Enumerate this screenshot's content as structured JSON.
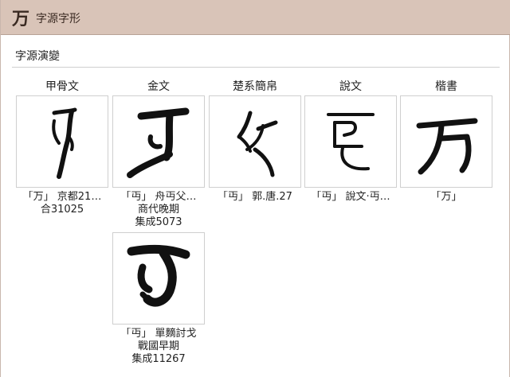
{
  "header": {
    "char": "万",
    "title": "字源字形"
  },
  "section": {
    "title": "字源演變"
  },
  "columns": [
    {
      "label": "甲骨文"
    },
    {
      "label": "金文"
    },
    {
      "label": "楚系簡帛"
    },
    {
      "label": "說文"
    },
    {
      "label": "楷書"
    }
  ],
  "items": [
    {
      "caption": "「万」 京都21…",
      "sub1": "合31025",
      "sub2": ""
    },
    {
      "caption": "「丏」 舟丏父…",
      "sub1": "商代晚期",
      "sub2": "集成5073"
    },
    {
      "caption": "「丏」 郭.唐.27",
      "sub1": "",
      "sub2": ""
    },
    {
      "caption": "「丏」 說文‧丏…",
      "sub1": "",
      "sub2": ""
    },
    {
      "caption": "「万」",
      "sub1": "",
      "sub2": ""
    },
    {
      "caption": "「丏」 單䵂討戈",
      "sub1": "戰國早期",
      "sub2": "集成11267"
    }
  ]
}
